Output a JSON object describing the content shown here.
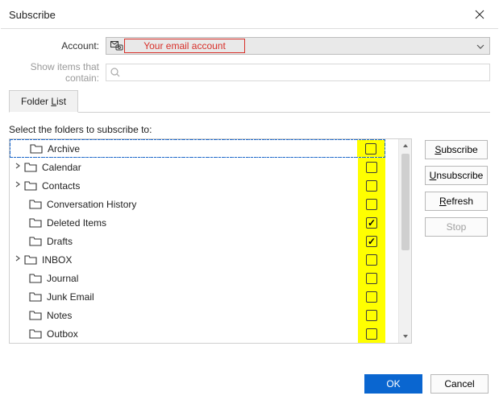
{
  "window": {
    "title": "Subscribe",
    "close_tooltip": "Close"
  },
  "labels": {
    "account": "Account:",
    "filter": "Show items that contain:",
    "instruction": "Select the folders to subscribe to:"
  },
  "account": {
    "placeholder_overlay": "Your email account"
  },
  "filter": {
    "value": ""
  },
  "tabs": {
    "folder_list": "Folder List",
    "folder_list_underline_char": "L"
  },
  "buttons": {
    "subscribe": "Subscribe",
    "unsubscribe": "Unsubscribe",
    "refresh": "Refresh",
    "stop": "Stop",
    "ok": "OK",
    "cancel": "Cancel"
  },
  "folders": [
    {
      "name": "Archive",
      "expandable": false,
      "indent": 1,
      "checked": false,
      "selected": true
    },
    {
      "name": "Calendar",
      "expandable": true,
      "indent": 0,
      "checked": false
    },
    {
      "name": "Contacts",
      "expandable": true,
      "indent": 0,
      "checked": false
    },
    {
      "name": "Conversation History",
      "expandable": false,
      "indent": 1,
      "checked": false
    },
    {
      "name": "Deleted Items",
      "expandable": false,
      "indent": 1,
      "checked": true
    },
    {
      "name": "Drafts",
      "expandable": false,
      "indent": 1,
      "checked": true
    },
    {
      "name": "INBOX",
      "expandable": true,
      "indent": 0,
      "checked": false
    },
    {
      "name": "Journal",
      "expandable": false,
      "indent": 1,
      "checked": false
    },
    {
      "name": "Junk Email",
      "expandable": false,
      "indent": 1,
      "checked": false
    },
    {
      "name": "Notes",
      "expandable": false,
      "indent": 1,
      "checked": false
    },
    {
      "name": "Outbox",
      "expandable": false,
      "indent": 1,
      "checked": false
    }
  ]
}
